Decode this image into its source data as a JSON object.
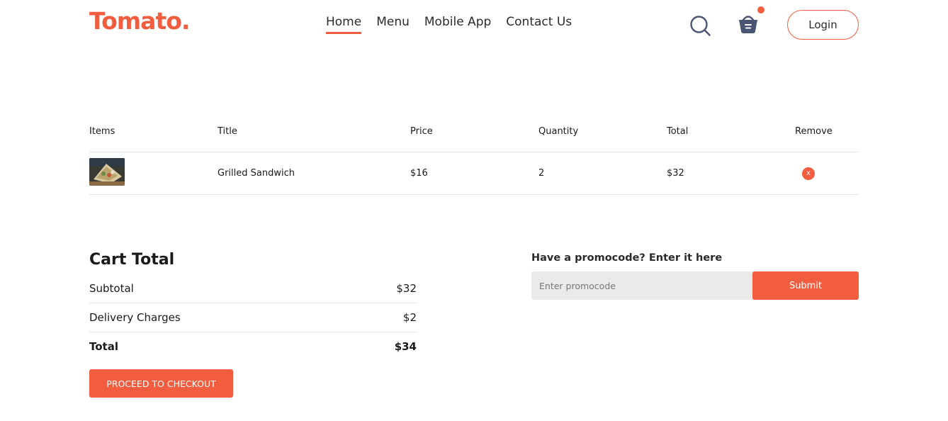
{
  "brand": {
    "logo_text": "Tomato.",
    "accent": "#f25c3f"
  },
  "nav": {
    "items": [
      {
        "label": "Home",
        "active": true
      },
      {
        "label": "Menu",
        "active": false
      },
      {
        "label": "Mobile App",
        "active": false
      },
      {
        "label": "Contact Us",
        "active": false
      }
    ],
    "search_icon": "search-icon",
    "basket_icon": "basket-icon",
    "login_label": "Login"
  },
  "table": {
    "headers": [
      "Items",
      "Title",
      "Price",
      "Quantity",
      "Total",
      "Remove"
    ],
    "rows": [
      {
        "image_icon": "grilled-sandwich-thumbnail",
        "title": "Grilled Sandwich",
        "price": "$16",
        "quantity": "2",
        "total": "$32",
        "remove_label": "x"
      }
    ]
  },
  "cart_total": {
    "title": "Cart Total",
    "subtotal_label": "Subtotal",
    "subtotal_value": "$32",
    "delivery_label": "Delivery Charges",
    "delivery_value": "$2",
    "total_label": "Total",
    "total_value": "$34",
    "checkout_label": "PROCEED TO CHECKOUT"
  },
  "promo": {
    "label": "Have a promocode? Enter it here",
    "placeholder": "Enter promocode",
    "submit_label": "Submit"
  }
}
